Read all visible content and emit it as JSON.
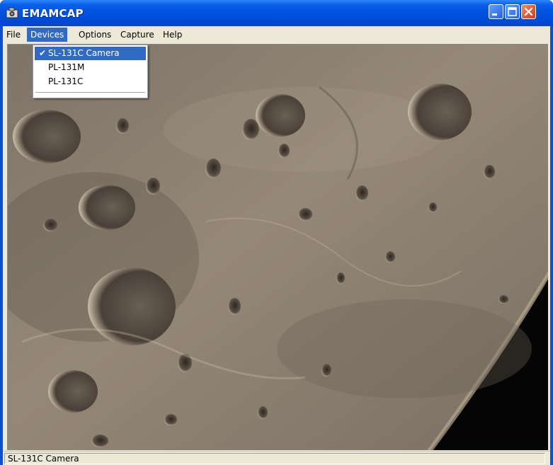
{
  "window": {
    "title": "EMAMCAP"
  },
  "menubar": {
    "items": [
      {
        "label": "File"
      },
      {
        "label": "Devices"
      },
      {
        "label": "Options"
      },
      {
        "label": "Capture"
      },
      {
        "label": "Help"
      }
    ],
    "active": "Devices"
  },
  "devices_menu": {
    "items": [
      {
        "label": "SL-131C Camera",
        "checked": true
      },
      {
        "label": "PL-131M",
        "checked": false
      },
      {
        "label": "PL-131C",
        "checked": false
      }
    ],
    "check_glyph": "✔"
  },
  "viewport": {
    "content": "camera-feed-moon-surface",
    "palette": {
      "bright": "#c9bca7",
      "mid": "#8f8273",
      "shadow": "#2d2620",
      "space": "#050505"
    }
  },
  "statusbar": {
    "text": "SL-131C Camera"
  },
  "colors": {
    "titlebar": "#0052e0",
    "menu_highlight": "#316ac5",
    "client": "#ece9d8"
  }
}
